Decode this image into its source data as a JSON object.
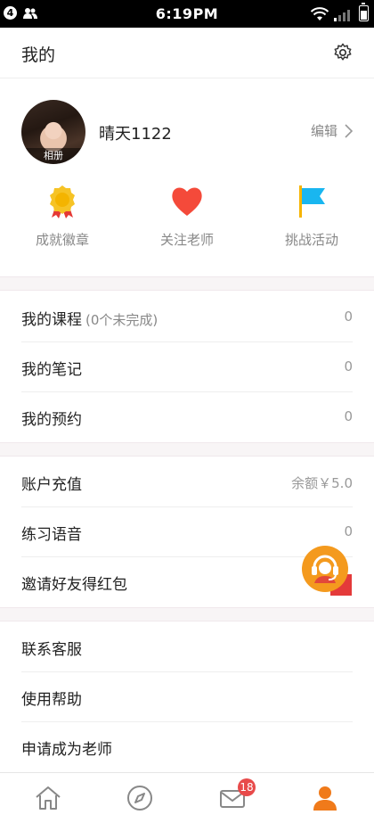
{
  "status_bar": {
    "notification_count": "4",
    "time": "6:19PM"
  },
  "header": {
    "title": "我的"
  },
  "profile": {
    "avatar_label": "相册",
    "username": "晴天1122",
    "edit_label": "编辑"
  },
  "quick_actions": [
    {
      "label": "成就徽章",
      "icon": "medal-icon"
    },
    {
      "label": "关注老师",
      "icon": "heart-icon"
    },
    {
      "label": "挑战活动",
      "icon": "flag-icon"
    }
  ],
  "section1": [
    {
      "label": "我的课程",
      "sub": "(0个未完成)",
      "value": "0"
    },
    {
      "label": "我的笔记",
      "value": "0"
    },
    {
      "label": "我的预约",
      "value": "0"
    }
  ],
  "section2": [
    {
      "label": "账户充值",
      "value": "余额￥5.0"
    },
    {
      "label": "练习语音",
      "value": "0"
    },
    {
      "label": "邀请好友得红包",
      "value": ""
    }
  ],
  "section3": [
    {
      "label": "联系客服"
    },
    {
      "label": "使用帮助"
    },
    {
      "label": "申请成为老师"
    }
  ],
  "tabbar": {
    "message_badge": "18",
    "active_color": "#f07a1a",
    "inactive_color": "#888888"
  }
}
